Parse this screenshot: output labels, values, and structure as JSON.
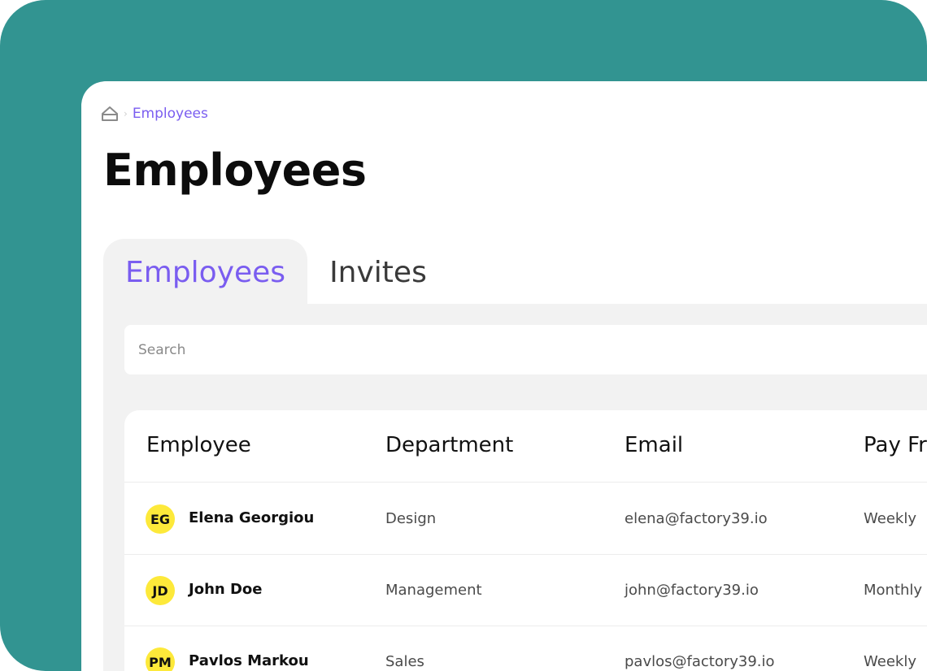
{
  "breadcrumb": {
    "home_icon": "home-icon",
    "current": "Employees"
  },
  "page": {
    "title": "Employees"
  },
  "tabs": [
    {
      "label": "Employees",
      "active": true
    },
    {
      "label": "Invites",
      "active": false
    }
  ],
  "search": {
    "placeholder": "Search",
    "value": ""
  },
  "table": {
    "columns": [
      "Employee",
      "Department",
      "Email",
      "Pay Fr"
    ],
    "rows": [
      {
        "initials": "EG",
        "name": "Elena Georgiou",
        "department": "Design",
        "email": "elena@factory39.io",
        "pay": "Weekly"
      },
      {
        "initials": "JD",
        "name": "John Doe",
        "department": "Management",
        "email": "john@factory39.io",
        "pay": "Monthly"
      },
      {
        "initials": "PM",
        "name": "Pavlos Markou",
        "department": "Sales",
        "email": "pavlos@factory39.io",
        "pay": "Weekly"
      }
    ]
  },
  "colors": {
    "background": "#329491",
    "accent": "#7a5df0",
    "avatar": "#fde93a",
    "panel": "#f2f2f2"
  }
}
